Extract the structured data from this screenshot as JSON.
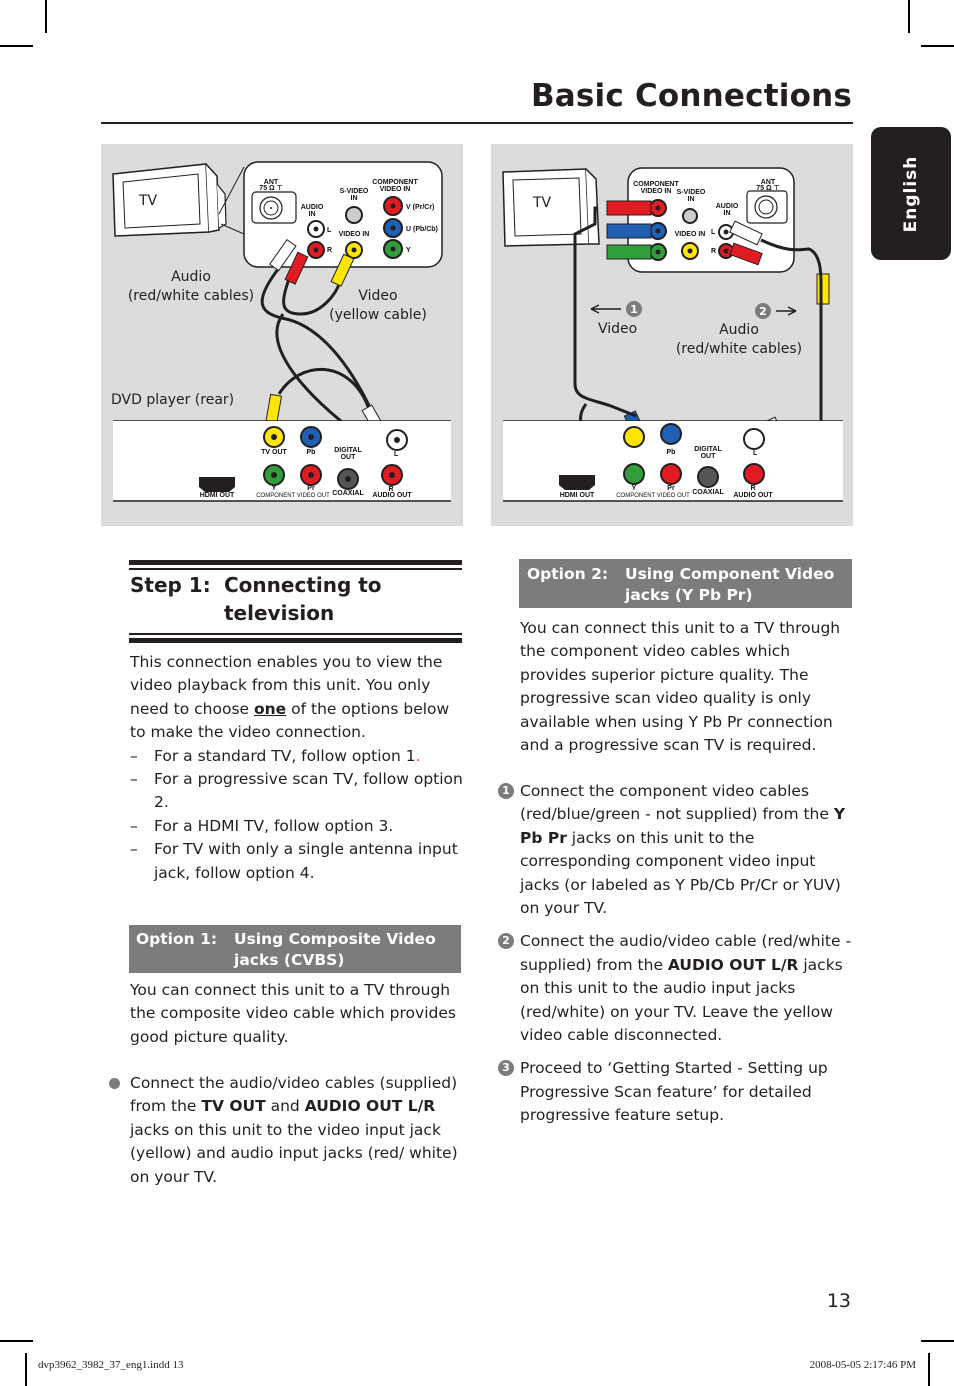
{
  "header": {
    "title": "Basic Connections",
    "language_tab": "English"
  },
  "diagram_left": {
    "tv_label": "TV",
    "tv_panel": {
      "ant": "ANT",
      "ant_sub": "75 Ω ⊤",
      "audio_in": [
        "AUDIO",
        "IN"
      ],
      "audio_l": "L",
      "audio_r": "R",
      "svideo_in": [
        "S-VIDEO",
        "IN"
      ],
      "video_in": "VIDEO IN",
      "component_video_in": [
        "COMPONENT",
        "VIDEO IN"
      ],
      "v": "V (Pr/Cr)",
      "u": "U (Pb/Cb)",
      "y": "Y"
    },
    "audio_caption": [
      "Audio",
      "(red/white cables)"
    ],
    "video_caption": [
      "Video",
      "(yellow cable)"
    ],
    "dvd_caption": "DVD player (rear)",
    "dvd_panel": {
      "hdmi_out": "HDMI OUT",
      "tv_out": "TV OUT",
      "pb": "Pb",
      "y": "Y",
      "pr": "Pr",
      "component_video_out": "COMPONENT VIDEO OUT",
      "digital_out": [
        "DIGITAL",
        "OUT"
      ],
      "coaxial": "COAXIAL",
      "audio_l": "L",
      "audio_r": "R",
      "audio_out": "AUDIO OUT"
    }
  },
  "diagram_right": {
    "tv_label": "TV",
    "tv_panel": {
      "component_video_in": [
        "COMPONENT",
        "VIDEO IN"
      ],
      "svideo_in": [
        "S-VIDEO",
        "IN"
      ],
      "video_in": "VIDEO IN",
      "audio_in": [
        "AUDIO",
        "IN"
      ],
      "audio_l": "L",
      "audio_r": "R",
      "ant": "ANT",
      "ant_sub": "75 Ω ⊤"
    },
    "callout_1": "1",
    "callout_2": "2",
    "video_caption": "Video",
    "audio_caption": [
      "Audio",
      "(red/white cables)"
    ],
    "dvd_panel": {
      "hdmi_out": "HDMI OUT",
      "pb": "Pb",
      "y": "Y",
      "pr": "Pr",
      "component_video_out": "COMPONENT VIDEO OUT",
      "digital_out": [
        "DIGITAL",
        "OUT"
      ],
      "coaxial": "COAXIAL",
      "audio_l": "L",
      "audio_r": "R",
      "audio_out": "AUDIO OUT"
    }
  },
  "step1": {
    "label": "Step 1:",
    "title_line1": "Connecting to",
    "title_line2": "television",
    "intro_a": "This connection enables you to view the video playback from this unit. You only need to choose ",
    "intro_emph": "one",
    "intro_b": " of the options below to make the video connection.",
    "options": [
      {
        "text": "For a standard TV, follow option 1",
        "suffix": "."
      },
      {
        "text": "For a progressive scan TV, follow option 2.",
        "suffix": ""
      },
      {
        "text": "For a HDMI TV, follow option 3.",
        "suffix": ""
      },
      {
        "text": "For TV with only a single antenna input jack, follow option 4.",
        "suffix": ""
      }
    ],
    "accent_color": "#e8611a"
  },
  "option1": {
    "label": "Option 1:",
    "title_line1": "Using Composite Video",
    "title_line2": "jacks (CVBS)",
    "description": "You can connect this unit to a TV through the composite video cable which provides good picture quality.",
    "bullet": {
      "t1": "Connect the audio/video cables (supplied) from the ",
      "b1": "TV OUT",
      "t2": " and ",
      "b2": "AUDIO OUT L/R",
      "t3": " jacks on this unit to the video input jack (yellow) and audio input jacks (red/ white) on your TV."
    }
  },
  "option2": {
    "label": "Option 2:",
    "title_line1": "Using Component Video",
    "title_line2": "jacks (Y Pb Pr)",
    "description": "You can connect this unit to a TV through the component video cables which provides superior picture quality. The progressive scan video quality is only available when using Y Pb Pr connection and a progressive scan TV is required.",
    "steps": [
      {
        "num": "1",
        "t1": "Connect the component video cables (red/blue/green - not supplied) from the ",
        "b1": "Y Pb Pr",
        "t2": " jacks on this unit to the corresponding component video input jacks (or labeled as Y Pb/Cb Pr/Cr or YUV) on your TV."
      },
      {
        "num": "2",
        "t1": "Connect the audio/video cable (red/white - supplied) from the ",
        "b1": "AUDIO OUT L/R",
        "t2": " jacks on this unit to the audio input jacks (red/white) on your TV. Leave the yellow video cable disconnected."
      },
      {
        "num": "3",
        "t1": "Proceed to ‘Getting Started - Setting up Progressive Scan feature’ for detailed progressive feature setup.",
        "b1": "",
        "t2": ""
      }
    ]
  },
  "footer": {
    "page_number": "13",
    "slug_left": "dvp3962_3982_37_eng1.indd   13",
    "slug_right": "2008-05-05   2:17:46 PM"
  },
  "colors": {
    "panel_bg": "#dcdcdd",
    "option_bar": "#7d7c7d",
    "text": "#231f20",
    "jack_red": "#e21b23",
    "jack_blue": "#1f5fb4",
    "jack_green": "#2f9e3b",
    "jack_yellow": "#ffe600"
  }
}
